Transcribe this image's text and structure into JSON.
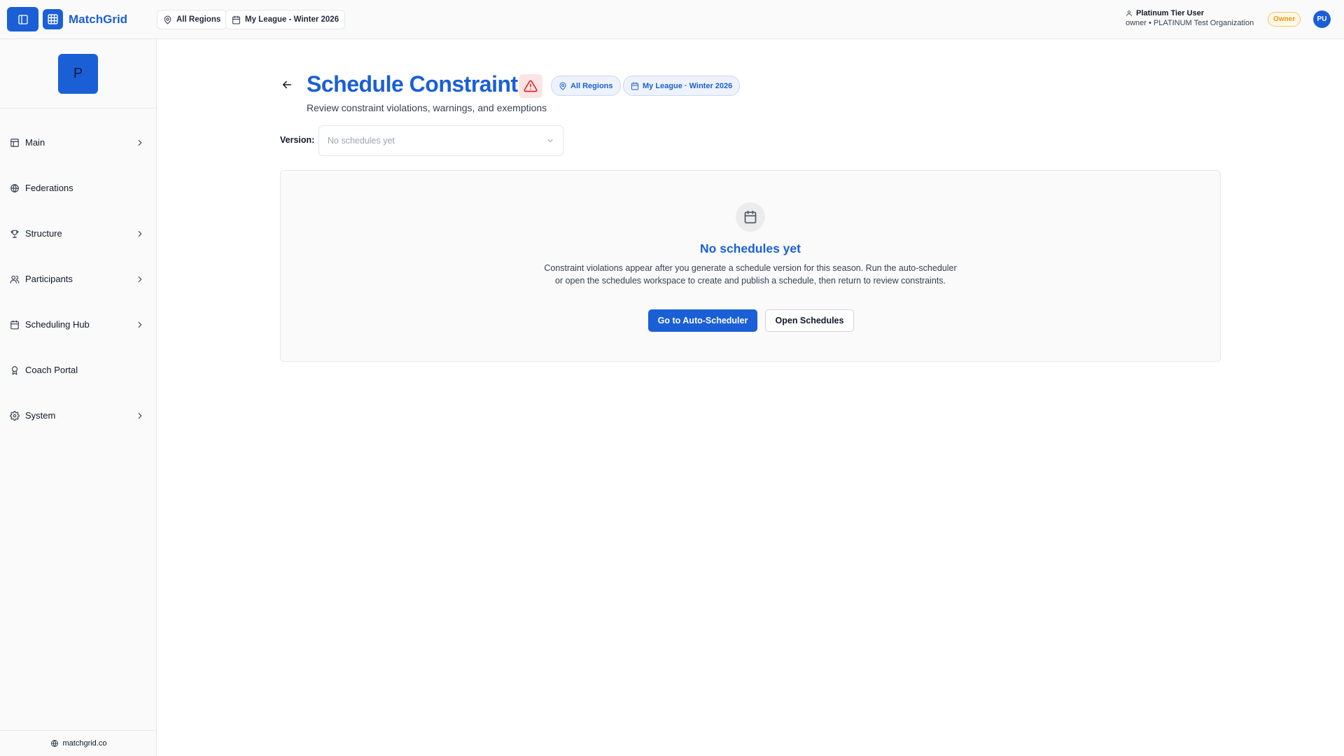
{
  "app": {
    "name": "MatchGrid",
    "brand_color": "#1a5fd6"
  },
  "topbar": {
    "region_chip": "All Regions",
    "league_chip": "My League - Winter 2026",
    "user": {
      "name": "Platinum Tier User",
      "org": "owner • PLATINUM Test Organization",
      "role_badge": "Owner",
      "initials": "PU"
    }
  },
  "sidebar": {
    "org_initial": "P",
    "items": [
      {
        "label": "Main",
        "icon": "layout-icon",
        "has_children": true
      },
      {
        "label": "Federations",
        "icon": "globe-icon",
        "has_children": false
      },
      {
        "label": "Structure",
        "icon": "trophy-icon",
        "has_children": true
      },
      {
        "label": "Participants",
        "icon": "users-icon",
        "has_children": true
      },
      {
        "label": "Scheduling Hub",
        "icon": "calendar-icon",
        "has_children": true
      },
      {
        "label": "Coach Portal",
        "icon": "award-icon",
        "has_children": false
      },
      {
        "label": "System",
        "icon": "gear-icon",
        "has_children": true
      }
    ],
    "footer": "matchgrid.co"
  },
  "main": {
    "title": "Schedule Constraints",
    "subtitle": "Review constraint violations, warnings, and exemptions",
    "region_chip": "All Regions",
    "season_chip": "My League · Winter 2026",
    "version_label": "Version:",
    "version_placeholder": "No schedules yet",
    "empty_state": {
      "title": "No schedules yet",
      "description": "Constraint violations appear after you generate a schedule version for this season. Run the auto-scheduler or open the schedules workspace to create and publish a schedule, then return to review constraints.",
      "primary_button": "Go to Auto-Scheduler",
      "secondary_button": "Open Schedules"
    }
  }
}
